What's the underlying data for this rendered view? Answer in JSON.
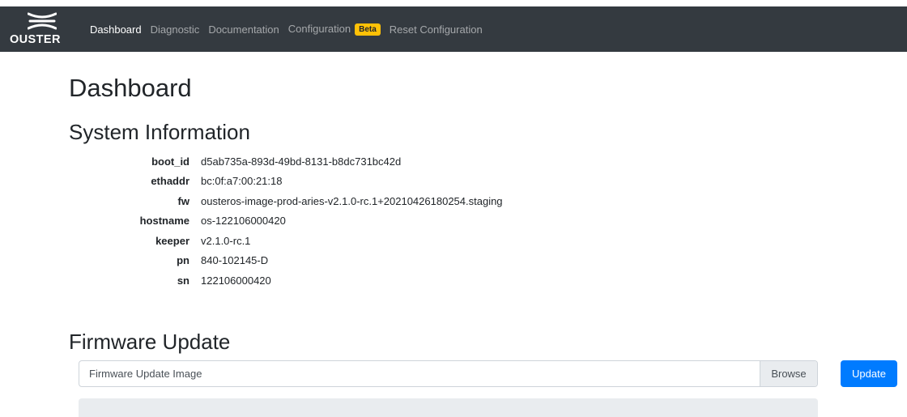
{
  "app": {
    "logo_text": "OUSTER"
  },
  "nav": {
    "items": [
      {
        "label": "Dashboard"
      },
      {
        "label": "Diagnostic"
      },
      {
        "label": "Documentation"
      },
      {
        "label": "Configuration"
      },
      {
        "label": "Reset Configuration"
      }
    ],
    "config_badge": "Beta"
  },
  "page": {
    "title": "Dashboard"
  },
  "system_info": {
    "title": "System Information",
    "rows": [
      {
        "key": "boot_id",
        "value": "d5ab735a-893d-49bd-8131-b8dc731bc42d"
      },
      {
        "key": "ethaddr",
        "value": "bc:0f:a7:00:21:18"
      },
      {
        "key": "fw",
        "value": "ousteros-image-prod-aries-v2.1.0-rc.1+20210426180254.staging"
      },
      {
        "key": "hostname",
        "value": "os-122106000420"
      },
      {
        "key": "keeper",
        "value": "v2.1.0-rc.1"
      },
      {
        "key": "pn",
        "value": "840-102145-D"
      },
      {
        "key": "sn",
        "value": "122106000420"
      }
    ]
  },
  "firmware": {
    "title": "Firmware Update",
    "file_label": "Firmware Update Image",
    "browse_label": "Browse",
    "update_label": "Update"
  },
  "colors": {
    "navbar": "#343a40",
    "primary": "#007bff",
    "badge": "#ffc107"
  }
}
